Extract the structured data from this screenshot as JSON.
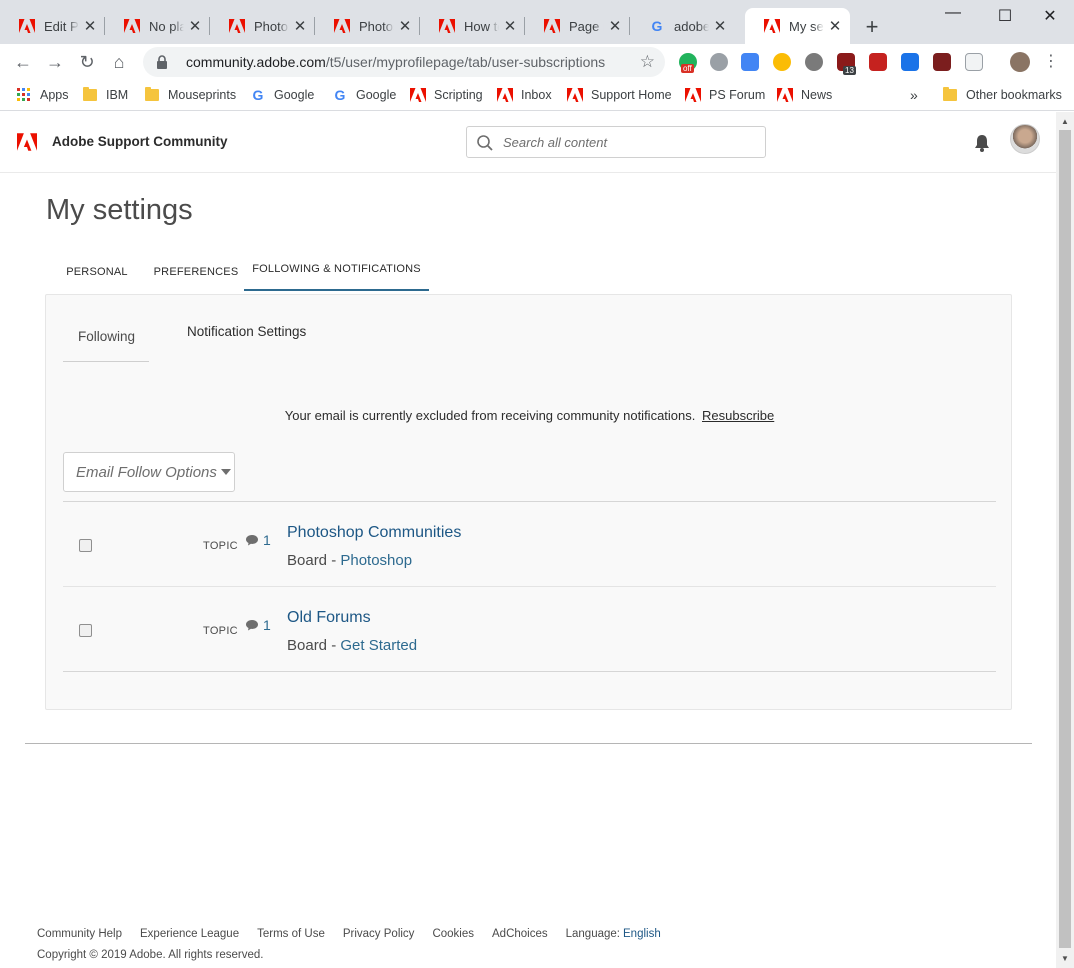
{
  "browser": {
    "tabs": [
      {
        "title": "Edit Post",
        "icon": "adobe-icon"
      },
      {
        "title": "No place",
        "icon": "adobe-icon"
      },
      {
        "title": "Photoshop",
        "icon": "adobe-icon"
      },
      {
        "title": "Photoshop",
        "icon": "adobe-icon"
      },
      {
        "title": "How to",
        "icon": "adobe-icon"
      },
      {
        "title": "Page not",
        "icon": "adobe-icon"
      },
      {
        "title": "adobe c",
        "icon": "google-icon"
      },
      {
        "title": "My settings",
        "icon": "adobe-icon",
        "active": true
      }
    ],
    "url_host": "community.adobe.com",
    "url_path": "/t5/user/myprofilepage/tab/user-subscriptions",
    "bookmarks": [
      {
        "label": "Apps",
        "icon": "apps-grid-icon"
      },
      {
        "label": "IBM",
        "icon": "folder-icon"
      },
      {
        "label": "Mouseprints",
        "icon": "folder-icon"
      },
      {
        "label": "Google",
        "icon": "google-icon"
      },
      {
        "label": "Google",
        "icon": "google-icon"
      },
      {
        "label": "Scripting",
        "icon": "adobe-icon"
      },
      {
        "label": "Inbox",
        "icon": "adobe-icon"
      },
      {
        "label": "Support Home",
        "icon": "adobe-icon"
      },
      {
        "label": "PS Forum",
        "icon": "adobe-icon"
      },
      {
        "label": "News",
        "icon": "adobe-icon"
      }
    ],
    "overflow": "»",
    "other_bookmarks": "Other bookmarks",
    "ext_badge_off": "off",
    "ext_badge_count": "13"
  },
  "site": {
    "brand": "Adobe Support Community",
    "search_placeholder": "Search all content"
  },
  "page": {
    "title": "My settings",
    "tabs": [
      "PERSONAL",
      "PREFERENCES",
      "FOLLOWING & NOTIFICATIONS"
    ],
    "subtabs": [
      "Following",
      "Notification Settings"
    ],
    "notice": "Your email is currently excluded from receiving community notifications.",
    "notice_link": "Resubscribe",
    "dropdown": "Email Follow Options",
    "items": [
      {
        "kind": "TOPIC",
        "count": "1",
        "title": "Photoshop Communities",
        "board_prefix": "Board - ",
        "board": "Photoshop"
      },
      {
        "kind": "TOPIC",
        "count": "1",
        "title": "Old Forums",
        "board_prefix": "Board - ",
        "board": "Get Started"
      }
    ]
  },
  "footer": {
    "links": [
      "Community Help",
      "Experience League",
      "Terms of Use",
      "Privacy Policy",
      "Cookies",
      "AdChoices"
    ],
    "language_label": "Language:",
    "language_value": "English",
    "copyright": "Copyright © 2019 Adobe. All rights reserved."
  },
  "colors": {
    "adobe_red": "#eb1000",
    "link_blue": "#1d5785",
    "tab_underline": "#2d6a8f"
  }
}
